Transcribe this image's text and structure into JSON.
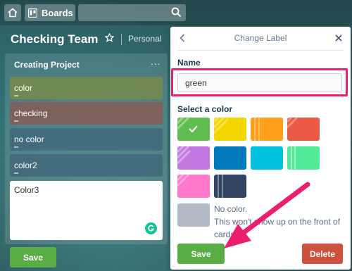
{
  "topbar": {
    "home_icon": "home-icon",
    "boards_label": "Boards",
    "boards_icon": "boards-icon",
    "search_icon": "search-icon"
  },
  "board": {
    "title": "Checking Team",
    "star_icon": "star-icon",
    "visibility": "Personal"
  },
  "list": {
    "title": "Creating Project",
    "menu": "...",
    "cards": [
      {
        "label": "color",
        "color": "#7d8c44"
      },
      {
        "label": "checking",
        "color": "#8e564e"
      },
      {
        "label": "no color",
        "color": "#3e6278"
      },
      {
        "label": "color2",
        "color": "#3e6278"
      }
    ],
    "editor_text": "Color3",
    "save_label": "Save"
  },
  "popover": {
    "title": "Change Label",
    "back_icon": "chevron-left-icon",
    "close_icon": "close-icon",
    "name_label": "Name",
    "name_value": "green",
    "select_label": "Select a color",
    "colors": [
      {
        "name": "green",
        "hex": "#61bd4f",
        "selected": true
      },
      {
        "name": "yellow",
        "hex": "#f2d600",
        "selected": false
      },
      {
        "name": "orange",
        "hex": "#ff9f1a",
        "selected": false
      },
      {
        "name": "red",
        "hex": "#eb5a46",
        "selected": false
      },
      {
        "name": "purple",
        "hex": "#c377e0",
        "selected": false
      },
      {
        "name": "blue",
        "hex": "#0079bf",
        "selected": false
      },
      {
        "name": "sky",
        "hex": "#00c2e0",
        "selected": false
      },
      {
        "name": "lime",
        "hex": "#51e898",
        "selected": false
      },
      {
        "name": "pink",
        "hex": "#ff78cb",
        "selected": false
      },
      {
        "name": "black",
        "hex": "#344563",
        "selected": false
      }
    ],
    "nocolor_title": "No color.",
    "nocolor_desc": "This won't show up on the front of cards.",
    "save_label": "Save",
    "delete_label": "Delete"
  },
  "annotation": {
    "highlight_color": "#ec1f6f"
  }
}
